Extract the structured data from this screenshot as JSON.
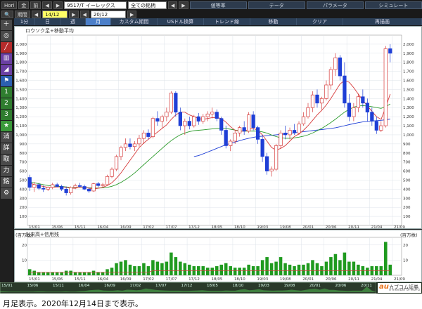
{
  "toolbar": {
    "hori_label": "Hori",
    "btn_kin": "金",
    "btn_mae": "前",
    "symbol": "9517/T イーレックス",
    "all_stocks": "全ての銘柄",
    "tabs": [
      "値等率",
      "テータ",
      "パラメータ",
      "シミュレート"
    ],
    "period_label": "期間",
    "date_from": "14/12",
    "date_to": "20/12"
  },
  "period_tabs": [
    "1分",
    "日",
    "週",
    "月",
    "カスタム期間",
    "USドル換算",
    "トレンド線",
    "移動",
    "クリア",
    "再描画"
  ],
  "active_period": "月",
  "sidebar_buttons": [
    "＋",
    "◎",
    "",
    "",
    "",
    "",
    "1",
    "2",
    "3",
    "★",
    "消",
    "詳",
    "取",
    "力",
    "銘",
    "⚙"
  ],
  "price_panel": {
    "title": "ロウソク足+移動平均",
    "y_ticks": [
      "2,000",
      "1,900",
      "1,800",
      "1,700",
      "1,600",
      "1,500",
      "1,400",
      "1,300",
      "1,200",
      "1,100",
      "1,000",
      "900",
      "800",
      "700",
      "600",
      "500",
      "400",
      "300",
      "200",
      "100"
    ]
  },
  "volume_panel": {
    "title": "出来高+信用残",
    "y_unit": "(百万株)",
    "y_ticks": [
      "20",
      "10"
    ]
  },
  "x_ticks": [
    "15/01",
    "15/06",
    "15/11",
    "16/04",
    "16/09",
    "17/02",
    "17/07",
    "17/12",
    "18/05",
    "18/10",
    "19/03",
    "19/08",
    "20/01",
    "20/06",
    "20/11",
    "21/04",
    "21/09"
  ],
  "timeline_ticks": [
    "15/01",
    "15/06",
    "15/11",
    "16/04",
    "16/09",
    "17/02",
    "17/07",
    "17/12",
    "18/05",
    "18/10",
    "19/03",
    "19/08",
    "20/01",
    "20/06",
    "20/11"
  ],
  "logo": {
    "brand": "au",
    "name": "カブコム証券",
    "sub": "A member of MUFG"
  },
  "caption": "月足表示。2020年12月14日まで表示。",
  "colors": {
    "up": "#d63b3b",
    "down": "#1f3fd6",
    "ma_short": "#d63b3b",
    "ma_mid": "#2a9a2a",
    "ma_long": "#1f3fd6",
    "volume": "#1f9a1f"
  },
  "chart_data": [
    {
      "type": "candlestick",
      "title": "ロウソク足+移動平均",
      "ylim": [
        0,
        2100
      ],
      "x_ticks": [
        "15/01",
        "15/06",
        "15/11",
        "16/04",
        "16/09",
        "17/02",
        "17/07",
        "17/12",
        "18/05",
        "18/10",
        "19/03",
        "19/08",
        "20/01",
        "20/06",
        "20/11",
        "21/04",
        "21/09"
      ],
      "candles": [
        [
          530,
          560,
          380,
          420
        ],
        [
          420,
          480,
          370,
          450
        ],
        [
          450,
          470,
          390,
          410
        ],
        [
          410,
          440,
          370,
          400
        ],
        [
          400,
          430,
          380,
          420
        ],
        [
          420,
          470,
          400,
          450
        ],
        [
          450,
          470,
          420,
          430
        ],
        [
          430,
          450,
          380,
          400
        ],
        [
          400,
          430,
          330,
          360
        ],
        [
          360,
          430,
          340,
          420
        ],
        [
          420,
          460,
          400,
          440
        ],
        [
          440,
          470,
          420,
          430
        ],
        [
          430,
          450,
          390,
          400
        ],
        [
          400,
          420,
          360,
          380
        ],
        [
          380,
          470,
          370,
          460
        ],
        [
          460,
          480,
          420,
          440
        ],
        [
          440,
          470,
          420,
          450
        ],
        [
          450,
          560,
          440,
          540
        ],
        [
          540,
          640,
          520,
          620
        ],
        [
          620,
          780,
          600,
          760
        ],
        [
          760,
          880,
          720,
          860
        ],
        [
          860,
          960,
          820,
          900
        ],
        [
          900,
          960,
          840,
          870
        ],
        [
          870,
          930,
          820,
          900
        ],
        [
          900,
          1000,
          870,
          960
        ],
        [
          960,
          1050,
          900,
          1020
        ],
        [
          1020,
          1060,
          950,
          980
        ],
        [
          980,
          1200,
          960,
          1180
        ],
        [
          1180,
          1260,
          1100,
          1150
        ],
        [
          1150,
          1220,
          1080,
          1200
        ],
        [
          1200,
          1300,
          1150,
          1250
        ],
        [
          1250,
          1480,
          1230,
          1460
        ],
        [
          1460,
          1480,
          1200,
          1250
        ],
        [
          1250,
          1300,
          1050,
          1100
        ],
        [
          1100,
          1180,
          1000,
          1150
        ],
        [
          1150,
          1200,
          1060,
          1100
        ],
        [
          1100,
          1220,
          1080,
          1200
        ],
        [
          1200,
          1240,
          1110,
          1150
        ],
        [
          1150,
          1230,
          1120,
          1200
        ],
        [
          1200,
          1260,
          1150,
          1230
        ],
        [
          1230,
          1300,
          1180,
          1250
        ],
        [
          1250,
          1280,
          1150,
          1180
        ],
        [
          1180,
          1200,
          1000,
          1050
        ],
        [
          1050,
          1100,
          850,
          880
        ],
        [
          880,
          950,
          820,
          930
        ],
        [
          930,
          1050,
          900,
          1020
        ],
        [
          1020,
          1100,
          980,
          1080
        ],
        [
          1080,
          1150,
          1000,
          1040
        ],
        [
          1040,
          1250,
          1020,
          1220
        ],
        [
          1220,
          1260,
          1050,
          1080
        ],
        [
          1080,
          1100,
          900,
          950
        ],
        [
          950,
          1000,
          700,
          760
        ],
        [
          760,
          800,
          560,
          600
        ],
        [
          600,
          650,
          540,
          620
        ],
        [
          620,
          900,
          600,
          880
        ],
        [
          880,
          1050,
          850,
          1020
        ],
        [
          1020,
          1100,
          950,
          1000
        ],
        [
          1000,
          1080,
          950,
          1050
        ],
        [
          1050,
          1120,
          1000,
          1020
        ],
        [
          1020,
          1150,
          1000,
          1120
        ],
        [
          1120,
          1250,
          1100,
          1200
        ],
        [
          1200,
          1350,
          1180,
          1300
        ],
        [
          1300,
          1480,
          1250,
          1440
        ],
        [
          1440,
          1500,
          1300,
          1350
        ],
        [
          1350,
          1420,
          1280,
          1400
        ],
        [
          1400,
          1600,
          1380,
          1550
        ],
        [
          1550,
          1750,
          1500,
          1720
        ],
        [
          1720,
          1900,
          1650,
          1850
        ],
        [
          1850,
          1880,
          1600,
          1650
        ],
        [
          1650,
          1800,
          1300,
          1350
        ],
        [
          1350,
          1450,
          1150,
          1200
        ],
        [
          1200,
          1350,
          1150,
          1300
        ],
        [
          1300,
          1450,
          1250,
          1420
        ],
        [
          1420,
          1500,
          1300,
          1350
        ],
        [
          1350,
          1400,
          1150,
          1250
        ],
        [
          1250,
          1300,
          1100,
          1150
        ],
        [
          1150,
          1200,
          1010,
          1050
        ],
        [
          1050,
          1150,
          1030,
          1100
        ],
        [
          1100,
          1980,
          1080,
          1950
        ],
        [
          1950,
          2000,
          1800,
          1900
        ]
      ],
      "ma_short": [
        470,
        450,
        440,
        430,
        420,
        420,
        425,
        425,
        420,
        410,
        410,
        420,
        420,
        410,
        400,
        410,
        420,
        440,
        470,
        520,
        580,
        650,
        720,
        790,
        860,
        910,
        950,
        990,
        1030,
        1070,
        1110,
        1170,
        1220,
        1250,
        1250,
        1220,
        1200,
        1180,
        1170,
        1180,
        1190,
        1190,
        1180,
        1140,
        1090,
        1050,
        1040,
        1040,
        1060,
        1070,
        1050,
        1000,
        930,
        860,
        830,
        850,
        880,
        930,
        980,
        1010,
        1050,
        1100,
        1160,
        1220,
        1270,
        1330,
        1400,
        1480,
        1560,
        1600,
        1580,
        1520,
        1450,
        1380,
        1320,
        1260,
        1200,
        1170,
        1300,
        1450
      ],
      "ma_mid": [
        480,
        470,
        460,
        450,
        440,
        435,
        430,
        430,
        425,
        420,
        418,
        418,
        418,
        415,
        412,
        412,
        414,
        420,
        432,
        450,
        475,
        505,
        540,
        580,
        625,
        670,
        715,
        760,
        805,
        850,
        895,
        935,
        970,
        1000,
        1020,
        1035,
        1045,
        1050,
        1055,
        1060,
        1065,
        1070,
        1072,
        1070,
        1062,
        1052,
        1045,
        1040,
        1040,
        1042,
        1040,
        1032,
        1018,
        998,
        980,
        968,
        962,
        962,
        966,
        974,
        984,
        1000,
        1020,
        1045,
        1072,
        1102,
        1135,
        1172,
        1212,
        1250,
        1282,
        1305,
        1318,
        1322,
        1318,
        1310,
        1300,
        1292,
        1310,
        1340
      ],
      "ma_long": [
        null,
        null,
        null,
        null,
        null,
        null,
        null,
        null,
        null,
        null,
        null,
        null,
        null,
        null,
        null,
        null,
        null,
        null,
        null,
        null,
        null,
        null,
        null,
        null,
        null,
        null,
        null,
        null,
        null,
        null,
        null,
        null,
        null,
        null,
        null,
        null,
        760,
        770,
        790,
        810,
        830,
        850,
        870,
        890,
        905,
        920,
        935,
        950,
        962,
        972,
        980,
        985,
        990,
        995,
        1000,
        1005,
        1010,
        1016,
        1022,
        1028,
        1034,
        1040,
        1046,
        1052,
        1058,
        1064,
        1070,
        1078,
        1088,
        1100,
        1112,
        1124,
        1134,
        1142,
        1148,
        1152,
        1156,
        1160,
        1166,
        1174
      ]
    },
    {
      "type": "bar",
      "title": "出来高+信用残",
      "ylabel": "(百万株)",
      "ylim": [
        0,
        25
      ],
      "values": [
        4,
        3,
        2,
        2,
        2,
        2,
        2,
        2,
        3,
        3,
        2,
        2,
        2,
        2,
        3,
        2,
        2,
        4,
        5,
        8,
        9,
        10,
        7,
        6,
        6,
        8,
        6,
        10,
        9,
        8,
        9,
        15,
        12,
        9,
        8,
        7,
        6,
        6,
        6,
        5,
        5,
        6,
        7,
        8,
        6,
        5,
        5,
        5,
        7,
        6,
        6,
        10,
        12,
        8,
        9,
        12,
        8,
        7,
        6,
        7,
        7,
        8,
        10,
        8,
        6,
        9,
        12,
        14,
        10,
        15,
        9,
        9,
        7,
        6,
        5,
        6,
        6,
        6,
        22,
        7
      ],
      "margin_line": [
        2,
        2,
        2,
        2,
        2,
        2,
        2,
        2,
        2,
        2,
        2,
        2,
        2,
        2,
        2,
        2,
        2,
        2,
        2,
        2,
        2,
        2,
        2,
        2,
        2,
        2,
        2,
        3,
        3,
        3,
        3,
        3,
        3,
        3,
        3,
        3,
        3,
        3,
        3,
        3,
        3,
        3,
        3,
        3,
        3,
        3,
        3,
        3,
        3,
        3,
        3,
        3,
        3,
        3,
        3,
        3,
        3,
        3,
        3,
        3,
        3,
        3,
        3,
        3,
        3,
        3,
        3,
        3,
        3,
        3,
        3,
        3,
        3,
        3,
        3,
        3,
        3,
        3,
        3,
        3
      ]
    }
  ]
}
